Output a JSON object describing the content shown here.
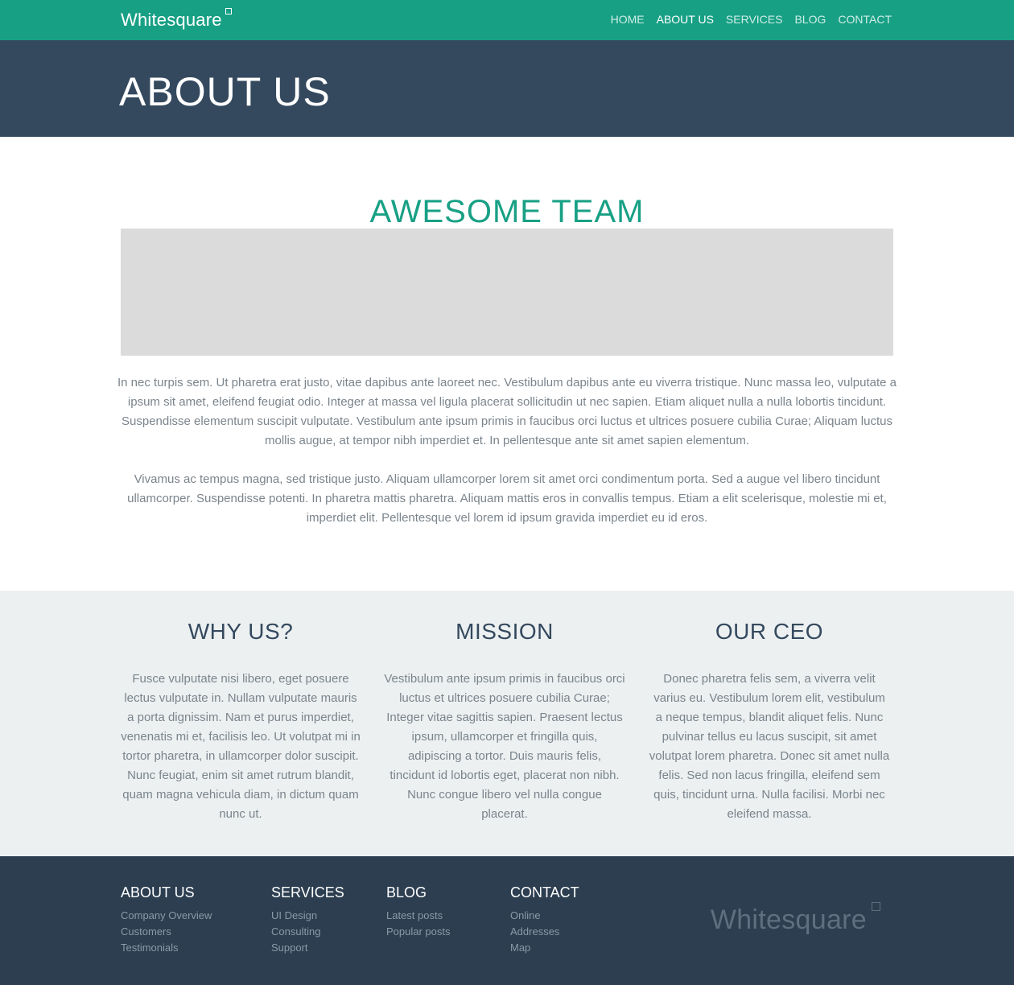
{
  "brand": {
    "name": "Whitesquare"
  },
  "nav": {
    "items": [
      "HOME",
      "ABOUT US",
      "SERVICES",
      "BLOG",
      "CONTACT"
    ],
    "active_index": 1
  },
  "page": {
    "title": "ABOUT US"
  },
  "team": {
    "title": "AWESOME TEAM",
    "paragraphs": [
      "In nec turpis sem. Ut pharetra erat justo, vitae dapibus ante laoreet nec. Vestibulum dapibus ante eu viverra tristique. Nunc massa leo, vulputate a ipsum sit amet, eleifend feugiat odio. Integer at massa vel ligula placerat sollicitudin ut nec sapien. Etiam aliquet nulla a nulla lobortis tincidunt. Suspendisse elementum suscipit vulputate. Vestibulum ante ipsum primis in faucibus orci luctus et ultrices posuere cubilia Curae; Aliquam luctus mollis augue, at tempor nibh imperdiet et. In pellentesque ante sit amet sapien elementum.",
      "Vivamus ac tempus magna, sed tristique justo. Aliquam ullamcorper lorem sit amet orci condimentum porta. Sed a augue vel libero tincidunt ullamcorper. Suspendisse potenti. In pharetra mattis pharetra. Aliquam mattis eros in convallis tempus. Etiam a elit scelerisque, molestie mi et, imperdiet elit. Pellentesque vel lorem id ipsum gravida imperdiet eu id eros."
    ]
  },
  "features": [
    {
      "title": "WHY US?",
      "text": "Fusce vulputate nisi libero, eget posuere lectus vulputate in. Nullam vulputate mauris a porta dignissim. Nam et purus imperdiet, venenatis mi et, facilisis leo. Ut volutpat mi in tortor pharetra, in ullamcorper dolor suscipit. Nunc feugiat, enim sit amet rutrum blandit, quam magna vehicula diam, in dictum quam nunc ut."
    },
    {
      "title": "MISSION",
      "text": "Vestibulum ante ipsum primis in faucibus orci luctus et ultrices posuere cubilia Curae; Integer vitae sagittis sapien. Praesent lectus ipsum, ullamcorper et fringilla quis, adipiscing a tortor. Duis mauris felis, tincidunt id lobortis eget, placerat non nibh. Nunc congue libero vel nulla congue placerat."
    },
    {
      "title": "OUR CEO",
      "text": "Donec pharetra felis sem, a viverra velit varius eu. Vestibulum lorem elit, vestibulum a neque tempus, blandit aliquet felis. Nunc pulvinar tellus eu lacus suscipit, sit amet volutpat lorem pharetra. Donec sit amet nulla felis. Sed non lacus fringilla, eleifend sem quis, tincidunt urna. Nulla facilisi. Morbi nec eleifend massa."
    }
  ],
  "footer": {
    "columns": [
      {
        "title": "ABOUT US",
        "links": [
          "Company Overview",
          "Customers",
          "Testimonials"
        ]
      },
      {
        "title": "SERVICES",
        "links": [
          "UI Design",
          "Consulting",
          "Support"
        ]
      },
      {
        "title": "BLOG",
        "links": [
          "Latest posts",
          "Popular posts"
        ]
      },
      {
        "title": "CONTACT",
        "links": [
          "Online",
          "Addresses",
          "Map"
        ]
      }
    ],
    "logo": "Whitesquare"
  },
  "colors": {
    "accent": "#18a085",
    "header_bg": "#34495e",
    "features_bg": "#ecf0f1",
    "footer_bg": "#2c3e50"
  }
}
